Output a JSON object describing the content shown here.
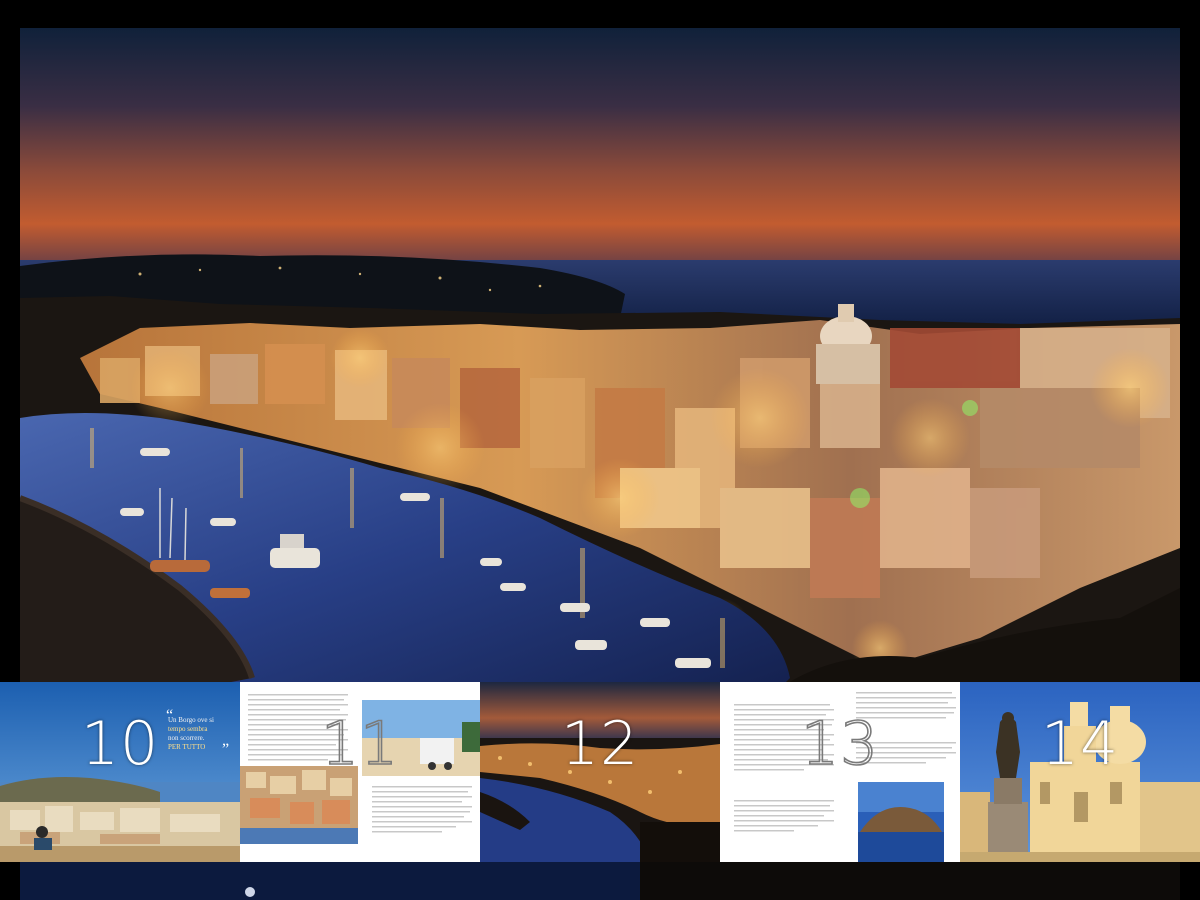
{
  "viewer": {
    "main_page": {
      "photo_subject": "harbour-village-at-dusk"
    },
    "thumbnails": [
      {
        "page_number": "10",
        "quote_lines": [
          "Un Borgo ove si",
          "tempo sembra",
          "non scorrere.",
          "PER TUTTO"
        ]
      },
      {
        "page_number": "11"
      },
      {
        "page_number": "12"
      },
      {
        "page_number": "13"
      },
      {
        "page_number": "14"
      }
    ],
    "colors": {
      "background": "#000000",
      "sky_top": "#12233c",
      "sky_horizon": "#c65a2c",
      "sea": "#2a3f7a",
      "town_lights": "#f3b24a",
      "page_paper": "#ffffff"
    }
  }
}
